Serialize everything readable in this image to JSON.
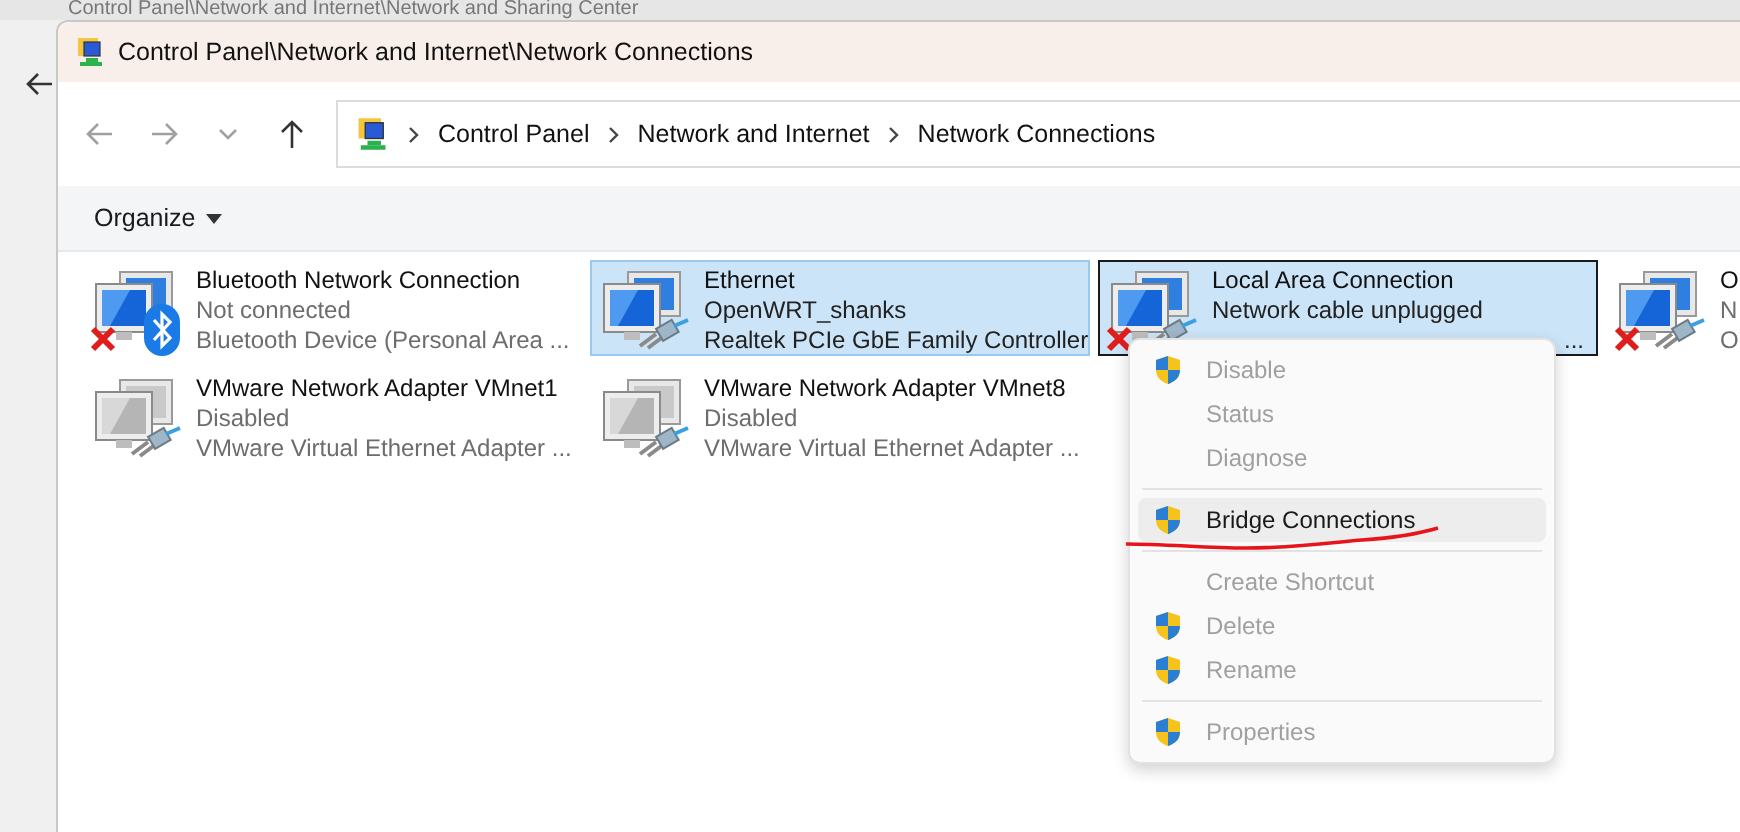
{
  "background_window": {
    "title": "Control Panel\\Network and Internet\\Network and Sharing Center"
  },
  "window": {
    "title": "Control Panel\\Network and Internet\\Network Connections"
  },
  "nav": [
    {
      "kind": "back",
      "disabled": true
    },
    {
      "kind": "forward",
      "disabled": true
    },
    {
      "kind": "recent",
      "disabled": true
    },
    {
      "kind": "up",
      "disabled": false
    }
  ],
  "breadcrumb": [
    "Control Panel",
    "Network and Internet",
    "Network Connections"
  ],
  "command_bar": {
    "organize": "Organize"
  },
  "connections": [
    {
      "name": "Bluetooth Network Connection",
      "status": "Not connected",
      "detail": "Bluetooth Device (Personal Area ...",
      "kind": "bluetooth",
      "disconnected": true,
      "disabled": false,
      "selected": false,
      "focused": false
    },
    {
      "name": "Ethernet",
      "status": "OpenWRT_shanks",
      "detail": "Realtek PCIe GbE Family Controller",
      "kind": "ethernet",
      "disconnected": false,
      "disabled": false,
      "selected": true,
      "focused": false
    },
    {
      "name": "Local Area Connection",
      "status": "Network cable unplugged",
      "detail_tail": "...",
      "kind": "ethernet",
      "disconnected": true,
      "disabled": false,
      "selected": true,
      "focused": true
    },
    {
      "name": "O",
      "status": "N",
      "detail": "O",
      "kind": "ethernet",
      "disconnected": true,
      "disabled": false,
      "selected": false,
      "focused": false
    },
    {
      "name": "VMware Network Adapter VMnet1",
      "status": "Disabled",
      "detail": "VMware Virtual Ethernet Adapter ...",
      "kind": "ethernet",
      "disconnected": false,
      "disabled": true,
      "selected": false,
      "focused": false
    },
    {
      "name": "VMware Network Adapter VMnet8",
      "status": "Disabled",
      "detail": "VMware Virtual Ethernet Adapter ...",
      "kind": "ethernet",
      "disconnected": false,
      "disabled": true,
      "selected": false,
      "focused": false
    }
  ],
  "context_menu": [
    {
      "kind": "item",
      "label": "Disable",
      "shield": true,
      "disabled": true,
      "highlighted": false
    },
    {
      "kind": "item",
      "label": "Status",
      "shield": false,
      "disabled": true,
      "highlighted": false
    },
    {
      "kind": "item",
      "label": "Diagnose",
      "shield": false,
      "disabled": true,
      "highlighted": false
    },
    {
      "kind": "separator"
    },
    {
      "kind": "item",
      "label": "Bridge Connections",
      "shield": true,
      "disabled": false,
      "highlighted": true
    },
    {
      "kind": "separator"
    },
    {
      "kind": "item",
      "label": "Create Shortcut",
      "shield": false,
      "disabled": true,
      "highlighted": false
    },
    {
      "kind": "item",
      "label": "Delete",
      "shield": true,
      "disabled": true,
      "highlighted": false
    },
    {
      "kind": "item",
      "label": "Rename",
      "shield": true,
      "disabled": true,
      "highlighted": false
    },
    {
      "kind": "separator"
    },
    {
      "kind": "item",
      "label": "Properties",
      "shield": true,
      "disabled": true,
      "highlighted": false
    }
  ],
  "annotations": [
    {
      "kind": "underline",
      "color": "#e8141b"
    }
  ]
}
